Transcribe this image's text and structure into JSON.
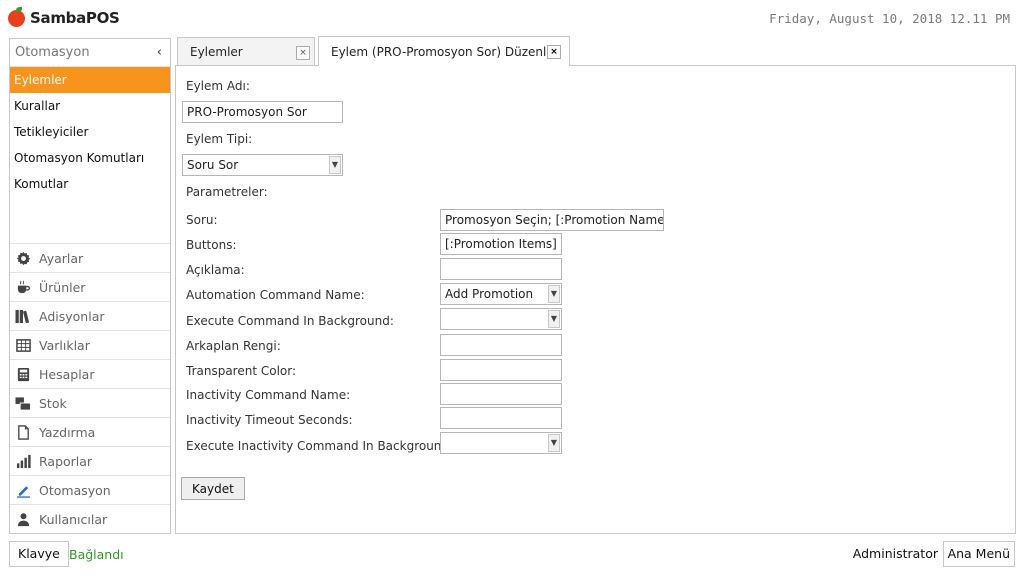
{
  "app": {
    "name": "SambaPOS",
    "datetime": "Friday, August 10, 2018 12.11 PM"
  },
  "sidebar": {
    "title": "Otomasyon",
    "collapse_glyph": "‹",
    "subitems": [
      "Eylemler",
      "Kurallar",
      "Tetikleyiciler",
      "Otomasyon Komutları",
      "Komutlar"
    ],
    "modules": [
      {
        "label": "Ayarlar",
        "icon": "gear-icon"
      },
      {
        "label": "Ürünler",
        "icon": "coffee-cup-icon"
      },
      {
        "label": "Adisyonlar",
        "icon": "books-icon"
      },
      {
        "label": "Varlıklar",
        "icon": "table-grid-icon"
      },
      {
        "label": "Hesaplar",
        "icon": "calculator-icon"
      },
      {
        "label": "Stok",
        "icon": "stock-boxes-icon"
      },
      {
        "label": "Yazdırma",
        "icon": "document-icon"
      },
      {
        "label": "Raporlar",
        "icon": "bar-chart-icon"
      },
      {
        "label": "Otomasyon",
        "icon": "pencil-icon"
      },
      {
        "label": "Kullanıcılar",
        "icon": "user-icon"
      }
    ]
  },
  "tabs": [
    {
      "label": "Eylemler",
      "close": "×"
    },
    {
      "label": "Eylem (PRO-Promosyon Sor) Düzenle",
      "close": "×"
    }
  ],
  "form": {
    "action_name_label": "Eylem Adı:",
    "action_name_value": "PRO-Promosyon Sor",
    "action_type_label": "Eylem Tipi:",
    "action_type_value": "Soru Sor",
    "parameters_label": "Parametreler:",
    "params": [
      {
        "label": "Soru:",
        "value": "Promosyon Seçin; [:Promotion Name]",
        "type": "text"
      },
      {
        "label": "Buttons:",
        "value": "[:Promotion Items]",
        "type": "text"
      },
      {
        "label": "Açıklama:",
        "value": "",
        "type": "text"
      },
      {
        "label": "Automation Command Name:",
        "value": "Add Promotion",
        "type": "select"
      },
      {
        "label": "Execute Command In Background:",
        "value": "",
        "type": "select"
      },
      {
        "label": "Arkaplan Rengi:",
        "value": "",
        "type": "text"
      },
      {
        "label": "Transparent Color:",
        "value": "",
        "type": "text"
      },
      {
        "label": "Inactivity Command Name:",
        "value": "",
        "type": "text"
      },
      {
        "label": "Inactivity Timeout Seconds:",
        "value": "",
        "type": "text"
      },
      {
        "label": "Execute Inactivity Command In Background:",
        "value": "",
        "type": "select"
      }
    ],
    "save_label": "Kaydet"
  },
  "footer": {
    "keyboard_label": "Klavye",
    "status": "Bağlandı",
    "user": "Administrator",
    "main_menu_label": "Ana Menü"
  },
  "colors": {
    "accent": "#f7941d",
    "connected": "#2e9a1e",
    "logo": "#e8401c"
  }
}
